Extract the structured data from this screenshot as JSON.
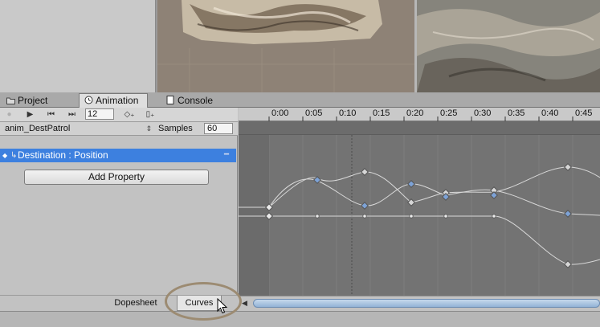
{
  "tabs": [
    {
      "label": "Project",
      "icon": "folder-icon"
    },
    {
      "label": "Animation",
      "icon": "clock-icon"
    },
    {
      "label": "Console",
      "icon": "console-icon"
    }
  ],
  "toolbar": {
    "frame_value": "12"
  },
  "clip": {
    "name": "anim_DestPatrol",
    "samples_label": "Samples",
    "samples_value": "60"
  },
  "property": {
    "label": "Destination : Position"
  },
  "add_property_label": "Add Property",
  "bottom_tabs": {
    "dopesheet": "Dopesheet",
    "curves": "Curves"
  },
  "timeline": {
    "ticks": [
      "0:00",
      "0:05",
      "0:10",
      "0:15",
      "0:20",
      "0:25",
      "0:30",
      "0:35",
      "0:40",
      "0:45"
    ]
  },
  "colors": {
    "selection": "#3d80df",
    "curve_bg": "#737373",
    "highlight_ring": "#9c8b72"
  }
}
